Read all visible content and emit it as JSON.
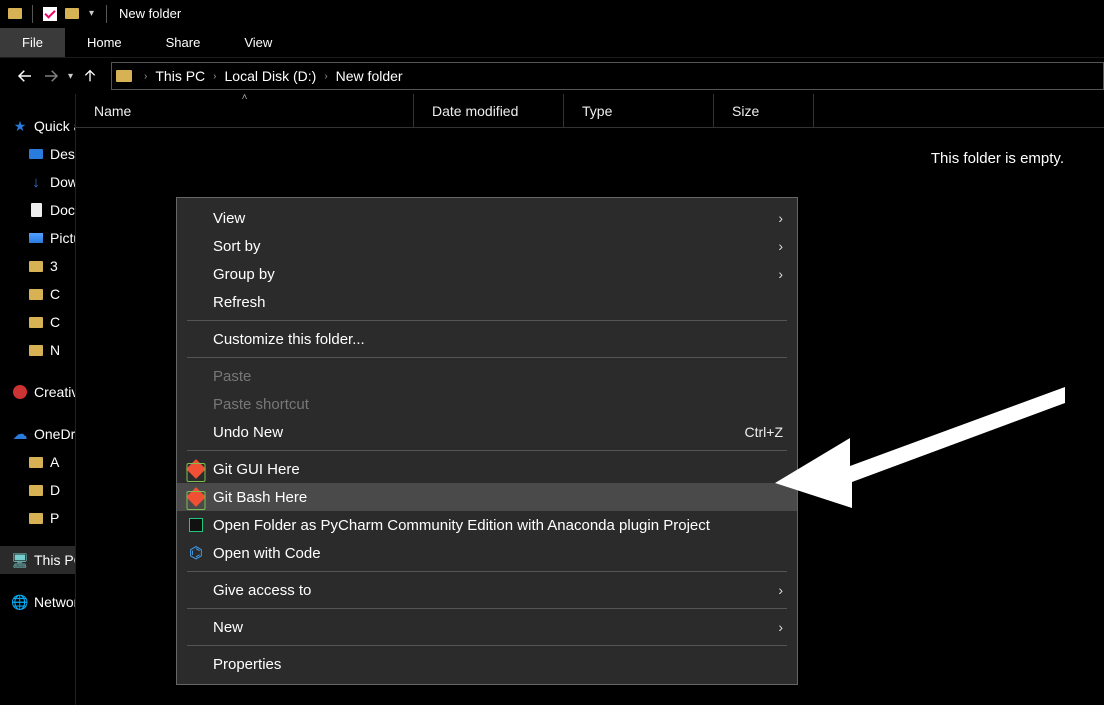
{
  "window": {
    "title": "New folder"
  },
  "ribbon": {
    "file": "File",
    "home": "Home",
    "share": "Share",
    "view": "View"
  },
  "breadcrumb": {
    "items": [
      "This PC",
      "Local Disk (D:)",
      "New folder"
    ]
  },
  "columns": {
    "name": "Name",
    "date": "Date modified",
    "type": "Type",
    "size": "Size"
  },
  "listview": {
    "empty_message": "This folder is empty."
  },
  "sidebar": {
    "quick": "Quick access",
    "desktop": "Desktop",
    "downloads": "Downloads",
    "documents": "Documents",
    "pictures": "Pictures",
    "f3": "3",
    "fc": "C",
    "fc2": "C",
    "fn": "N",
    "creative": "Creative Cloud",
    "onedrive": "OneDrive",
    "fa": "A",
    "fd": "D",
    "fp": "P",
    "thispc": "This PC",
    "network": "Network"
  },
  "contextmenu": {
    "view": "View",
    "sortby": "Sort by",
    "groupby": "Group by",
    "refresh": "Refresh",
    "customize": "Customize this folder...",
    "paste": "Paste",
    "paste_shortcut": "Paste shortcut",
    "undo_new": "Undo New",
    "undo_new_sc": "Ctrl+Z",
    "git_gui": "Git GUI Here",
    "git_bash": "Git Bash Here",
    "pycharm": "Open Folder as PyCharm Community Edition with Anaconda plugin Project",
    "vscode": "Open with Code",
    "give_access": "Give access to",
    "new": "New",
    "properties": "Properties"
  }
}
